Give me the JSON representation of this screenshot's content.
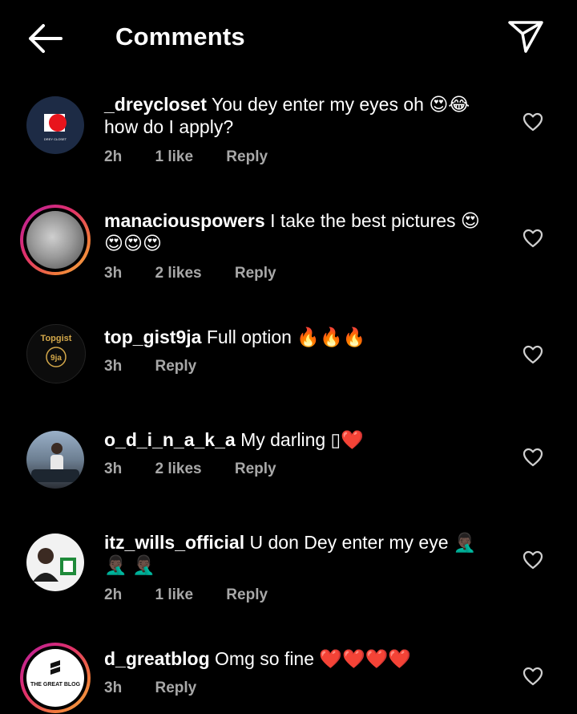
{
  "header": {
    "title": "Comments"
  },
  "comments": [
    {
      "user": "_dreycloset",
      "text": "You dey enter my eyes oh 😍😂 how do I apply?",
      "time": "2h",
      "likes": "1 like",
      "reply": "Reply",
      "avatar_text": "DREY CLOSET"
    },
    {
      "user": "manaciouspowers",
      "text": "I take the best pictures 😍 😍😍😍",
      "time": "3h",
      "likes": "2 likes",
      "reply": "Reply"
    },
    {
      "user": "top_gist9ja",
      "text": "Full option 🔥🔥🔥",
      "time": "3h",
      "reply": "Reply",
      "avatar_text": "Topgist",
      "avatar_sub": "9ja"
    },
    {
      "user": "o_d_i_n_a_k_a",
      "text": "My darling ▯❤️",
      "time": "3h",
      "likes": "2 likes",
      "reply": "Reply"
    },
    {
      "user": "itz_wills_official",
      "text": "U don Dey enter my eye 🤦🏿‍♂️🤦🏿‍♂️ 🤦🏿‍♂️",
      "time": "2h",
      "likes": "1 like",
      "reply": "Reply"
    },
    {
      "user": "d_greatblog",
      "text": "Omg so fine ❤️❤️❤️❤️",
      "time": "3h",
      "reply": "Reply",
      "avatar_text": "THE GREAT BLOG"
    }
  ]
}
